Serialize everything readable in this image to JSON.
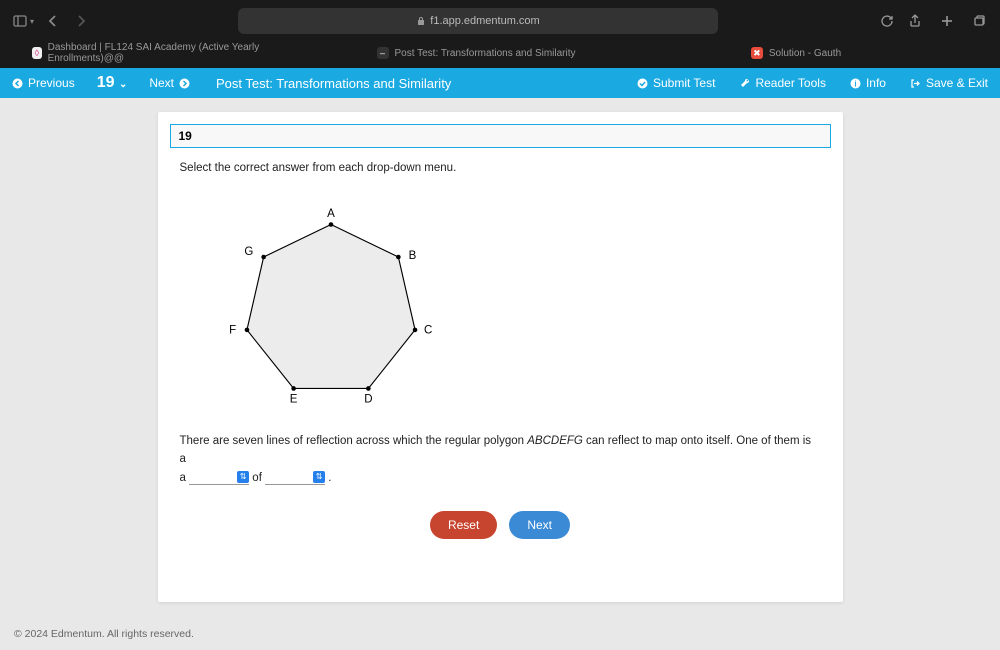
{
  "browser": {
    "url": "f1.app.edmentum.com",
    "tabs": [
      {
        "label": "Dashboard | FL124 SAI Academy (Active Yearly Enrollments)@@"
      },
      {
        "label": "Post Test: Transformations and Similarity"
      },
      {
        "label": "Solution - Gauth"
      }
    ]
  },
  "toolbar": {
    "prev": "Previous",
    "number": "19",
    "next": "Next",
    "title": "Post Test: Transformations and Similarity",
    "submit": "Submit Test",
    "reader": "Reader Tools",
    "info": "Info",
    "saveexit": "Save & Exit"
  },
  "question": {
    "number": "19",
    "instruction": "Select the correct answer from each drop-down menu.",
    "vertices": {
      "A": "A",
      "B": "B",
      "C": "C",
      "D": "D",
      "E": "E",
      "F": "F",
      "G": "G"
    },
    "text_a": "There are seven lines of reflection across which the regular polygon ",
    "poly": "ABCDEFG",
    "text_b": " can reflect to map onto itself. One of them is a ",
    "of": " of ",
    "period": " ."
  },
  "buttons": {
    "reset": "Reset",
    "next": "Next"
  },
  "footer": "© 2024 Edmentum. All rights reserved."
}
